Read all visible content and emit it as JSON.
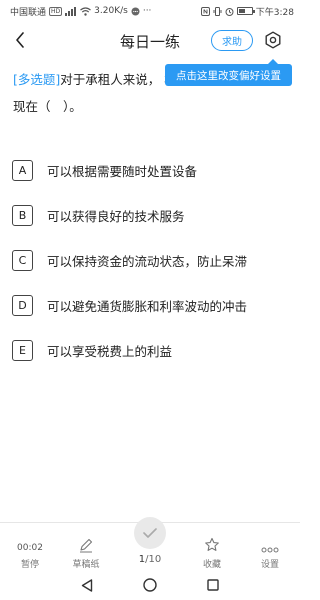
{
  "status_bar": {
    "carrier": "中国联通",
    "hd": "HD",
    "network": "4G",
    "speed": "3.20K/s",
    "time": "下午3:28",
    "battery_level": 0.55
  },
  "header": {
    "title": "每日一练",
    "help_label": "求助"
  },
  "tooltip": {
    "text": "点击这里改变偏好设置"
  },
  "question": {
    "type": "[多选题]",
    "text": "对于承租人来说，                    相比的优越性主要体现在（　）。"
  },
  "options": [
    {
      "letter": "A",
      "text": "可以根据需要随时处置设备"
    },
    {
      "letter": "B",
      "text": "可以获得良好的技术服务"
    },
    {
      "letter": "C",
      "text": "可以保持资金的流动状态，防止呆滞"
    },
    {
      "letter": "D",
      "text": "可以避免通货膨胀和利率波动的冲击"
    },
    {
      "letter": "E",
      "text": "可以享受税费上的利益"
    }
  ],
  "toolbar": {
    "timer": "00:02",
    "pause_label": "暂停",
    "draft_label": "草稿纸",
    "current_page": "1",
    "total_pages": "/10",
    "favorite_label": "收藏",
    "settings_label": "设置"
  },
  "colors": {
    "accent": "#2b9af3"
  }
}
